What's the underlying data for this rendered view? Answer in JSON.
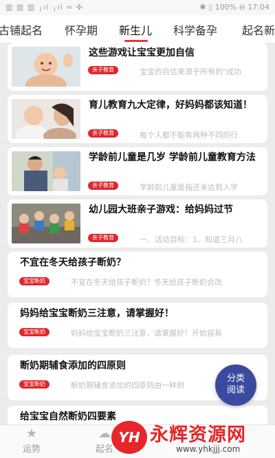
{
  "status_bar": {
    "left": "▥ ▥ ▥ ╷ıl ╷ıl ≈ ✣",
    "right": "✱ ▯ 100% ⊖ 17:04"
  },
  "tabs": [
    "古铺起名",
    "怀孕期",
    "新生儿",
    "科学备孕",
    "起名新"
  ],
  "active_tab_index": 2,
  "accent_color": "#e0262b",
  "articles": [
    {
      "title": "这些游戏让宝宝更加自信",
      "tag": "亲子教育",
      "snippet": "宝宝的自信来源于所有的\"成功",
      "has_image": true
    },
    {
      "title": "育儿教育九大定律，好妈妈都该知道！",
      "tag": "亲子教育",
      "snippet": "每个人都不能有两种不同的行",
      "has_image": true
    },
    {
      "title": "学龄前儿童是几岁 学龄前儿童教育方法",
      "tag": "亲子教育",
      "snippet": "学龄前儿童是指还未达到入学",
      "has_image": true
    },
    {
      "title": "幼儿园大班亲子游戏：给妈妈过节",
      "tag": "亲子教育",
      "snippet": "一、活动目标：1、知道三月八",
      "has_image": true
    },
    {
      "title": "不宜在冬天给孩子断奶？",
      "tag": "宝宝断奶",
      "snippet": "不宜在冬天给孩子断奶？冬天给孩子断奶会改",
      "has_image": false
    },
    {
      "title": "妈妈给宝宝断奶三注意，请掌握好！",
      "tag": "宝宝断奶",
      "snippet": "妈妈给宝宝断奶三注意，请掌握好！开始容易",
      "has_image": false
    },
    {
      "title": "断奶期辅食添加的四原则",
      "tag": "宝宝断奶",
      "snippet": "断奶期辅食添加的四原则由一种到",
      "has_image": false
    },
    {
      "title": "给宝宝自然断奶四要素",
      "tag": "",
      "snippet": "",
      "has_image": false
    }
  ],
  "float_button": {
    "line1": "分类",
    "line2": "阅读"
  },
  "bottom_nav": [
    {
      "icon": "star-icon",
      "label": "运势"
    },
    {
      "icon": "name-icon",
      "label": "起名"
    }
  ],
  "watermark": {
    "logo": "YH",
    "main": "永辉资源网",
    "url": "www.yhkjjj.com"
  }
}
